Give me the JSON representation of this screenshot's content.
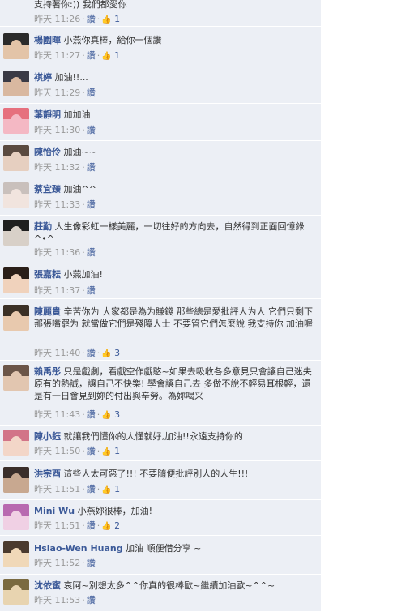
{
  "first_comment": {
    "text": "支持著你:)) 我們都愛你",
    "time": "昨天 11:26",
    "like": "讚",
    "likes": "1"
  },
  "comments": [
    {
      "name": "楊園暉",
      "text": "小燕你真棒，給你一個讚",
      "time": "昨天 11:27",
      "like": "讚",
      "likes": "1",
      "avatar": [
        "#2b2b2b",
        "#e3c4a8"
      ]
    },
    {
      "name": "褀婷",
      "text": "加油!!...",
      "time": "昨天 11:29",
      "like": "讚",
      "likes": "",
      "avatar": [
        "#3a3a45",
        "#d9b8a0"
      ]
    },
    {
      "name": "葉靜明",
      "text": "加加油",
      "time": "昨天 11:30",
      "like": "讚",
      "likes": "",
      "avatar": [
        "#e6707e",
        "#f4b8c4"
      ]
    },
    {
      "name": "陳怡伶",
      "text": "加油~~",
      "time": "昨天 11:32",
      "like": "讚",
      "likes": "",
      "avatar": [
        "#5a4a40",
        "#e6cfc0"
      ]
    },
    {
      "name": "蔡宜臻",
      "text": "加油^^",
      "time": "昨天 11:33",
      "like": "讚",
      "likes": "",
      "avatar": [
        "#c9c0bc",
        "#f1e4de"
      ]
    },
    {
      "name": "莊勤",
      "text": "人生像彩虹一樣美麗，一切往好的方向去，自然得到正面回憶錄^•^",
      "time": "昨天 11:36",
      "like": "讚",
      "likes": "",
      "avatar": [
        "#1f1f1f",
        "#d8d0c8"
      ]
    },
    {
      "name": "張嘉耘",
      "text": "小燕加油!",
      "time": "昨天 11:37",
      "like": "讚",
      "likes": "",
      "avatar": [
        "#2a1e18",
        "#f0d2bc"
      ]
    },
    {
      "name": "陳麗貴",
      "text": "辛苦你为 大家都是為为賺錢 那些總是愛批評人为人 它們只剩下那張嘴罷为 就當做它們是殘障人士 不要管它們怎麼說 我支持你 加油喔",
      "time": "昨天 11:40",
      "like": "讚",
      "likes": "3",
      "avatar": [
        "#3b3026",
        "#e8c9ae"
      ]
    },
    {
      "name": "賴禹彤",
      "text": "只是戲劇，看戲空作戲憨~如果去吸收各多意見只會讓自己迷失原有的熱誠，讓自己不快樂! 學會讓自己去 多做不說不輕易耳根輕，還是有一日會見到妳的付出與辛勞。為妳喝采",
      "time": "昨天 11:43",
      "like": "讚",
      "likes": "3",
      "avatar": [
        "#6b5548",
        "#e2c6b0"
      ]
    },
    {
      "name": "陳小鈺",
      "text": "就讓我們懂你的人懂就好,加油!!永遠支持你的",
      "time": "昨天 11:50",
      "like": "讚",
      "likes": "1",
      "avatar": [
        "#d27488",
        "#f3d6c8"
      ]
    },
    {
      "name": "洪宗酉",
      "text": "這些人太可惡了!!! 不要隨便批評別人的人生!!!",
      "time": "昨天 11:51",
      "like": "讚",
      "likes": "1",
      "avatar": [
        "#3a2e2a",
        "#c8a890"
      ]
    },
    {
      "name": "Mini Wu",
      "text": "小燕妳很棒，加油!",
      "time": "昨天 11:51",
      "like": "讚",
      "likes": "2",
      "avatar": [
        "#b86ab0",
        "#f0d0e4"
      ]
    },
    {
      "name": "Hsiao-Wen Huang",
      "text": "加油 順便借分享 ~",
      "time": "昨天 11:52",
      "like": "讚",
      "likes": "",
      "avatar": [
        "#4a3a2e",
        "#f0d8b8"
      ]
    },
    {
      "name": "沈依蜜",
      "text": "哀阿~別想太多^^你真的很棒歐~繼續加油歐~^^~",
      "time": "昨天 11:53",
      "like": "讚",
      "likes": "",
      "avatar": [
        "#7a6a40",
        "#e8d4b0"
      ]
    }
  ],
  "colors": {
    "panel_bg": "#eceff5",
    "link": "#3b5998",
    "meta": "#999999",
    "text": "#333333"
  }
}
